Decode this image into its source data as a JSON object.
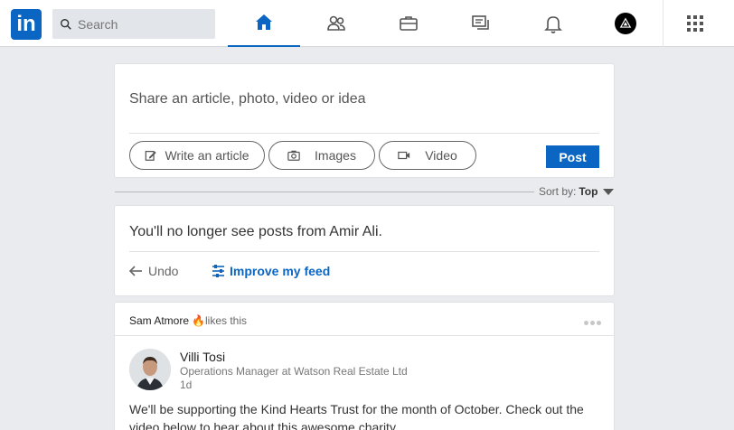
{
  "nav": {
    "logo_text": "in",
    "search_placeholder": "Search",
    "icons": [
      "home-icon",
      "network-icon",
      "jobs-icon",
      "messaging-icon",
      "notifications-icon",
      "me-avatar",
      "work-grid-icon"
    ],
    "accent": "#0a66c2"
  },
  "share": {
    "prompt": "Share an article, photo, video or idea",
    "article_label": "Write an article",
    "images_label": "Images",
    "video_label": "Video",
    "post_label": "Post"
  },
  "sort": {
    "label": "Sort by:",
    "value": "Top"
  },
  "hidden": {
    "message": "You'll no longer see posts from Amir Ali.",
    "undo_label": "Undo",
    "improve_label": "Improve my feed"
  },
  "post": {
    "liker_name": "Sam Atmore",
    "liker_action": "likes this",
    "author_name": "Villi Tosi",
    "author_title": "Operations Manager at Watson Real Estate Ltd",
    "time": "1d",
    "body": "We'll be supporting the Kind Hearts Trust for the month of October. Check out the video below to hear about this awesome charity."
  }
}
